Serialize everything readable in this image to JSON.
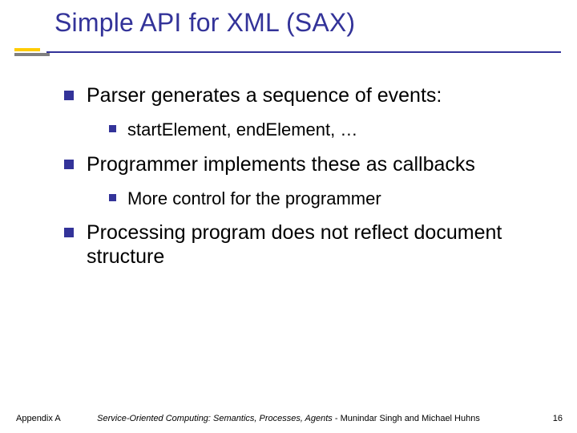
{
  "header": {
    "title": "Simple API for XML (SAX)"
  },
  "content": {
    "items": [
      {
        "text": "Parser generates a sequence of events:",
        "sub": [
          {
            "text": "startElement, endElement, …"
          }
        ]
      },
      {
        "text": "Programmer implements these as callbacks",
        "sub": [
          {
            "text": "More control for the programmer"
          }
        ]
      },
      {
        "text": "Processing program does not reflect document structure",
        "sub": []
      }
    ]
  },
  "footer": {
    "left": "Appendix A",
    "center_italic": "Service-Oriented Computing: Semantics, Processes, Agents",
    "center_rest": " - Munindar Singh and Michael Huhns",
    "pagenum": "16"
  }
}
